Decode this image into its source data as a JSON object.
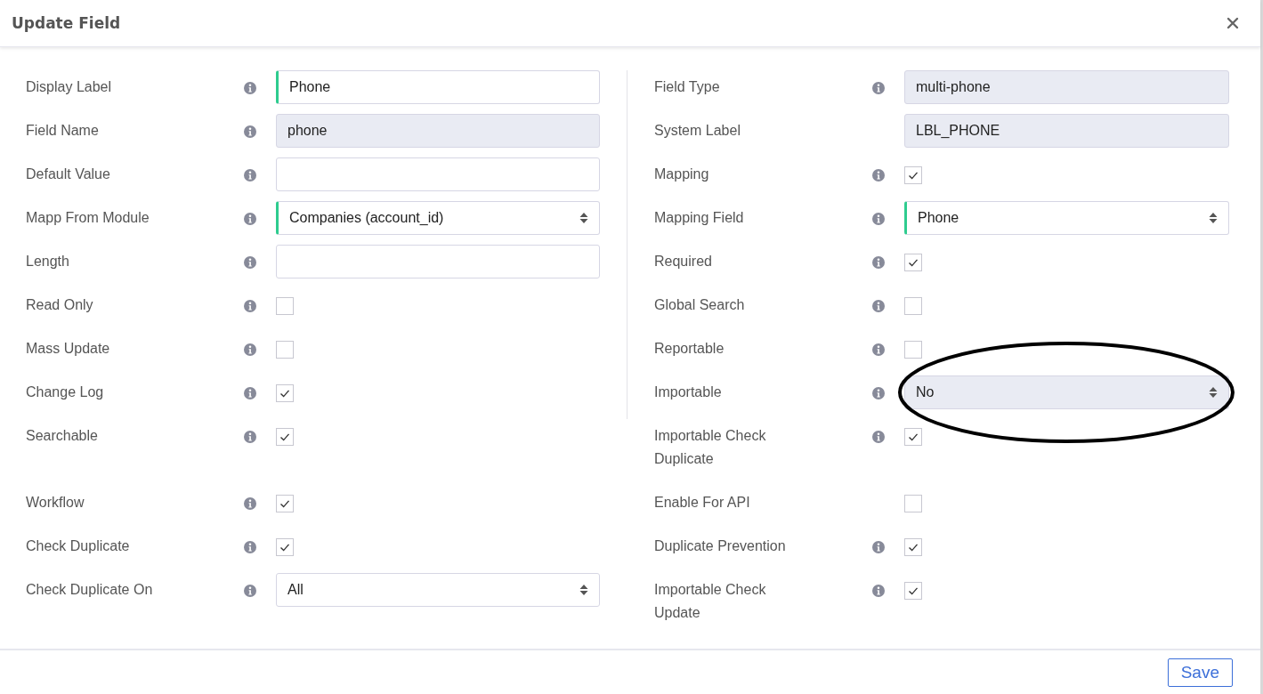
{
  "dialog": {
    "title": "Update Field"
  },
  "left_fields": [
    {
      "label": "Display Label",
      "info": true,
      "kind": "text",
      "value": "Phone",
      "required": true,
      "disabled": false
    },
    {
      "label": "Field Name",
      "info": true,
      "kind": "text",
      "value": "phone",
      "required": false,
      "disabled": true
    },
    {
      "label": "Default Value",
      "info": true,
      "kind": "text",
      "required": false,
      "disabled": false
    },
    {
      "label": "Mapp From Module",
      "info": true,
      "kind": "select",
      "value": "Companies (account_id)",
      "required": true,
      "disabled": false
    },
    {
      "label": "Length",
      "info": true,
      "kind": "text",
      "required": false,
      "disabled": false
    },
    {
      "label": "Read Only",
      "info": true,
      "kind": "checkbox",
      "checked": false
    },
    {
      "label": "Mass Update",
      "info": true,
      "kind": "checkbox",
      "checked": false
    },
    {
      "label": "Change Log",
      "info": true,
      "kind": "checkbox",
      "checked": true
    },
    {
      "label": "Searchable",
      "info": true,
      "kind": "checkbox",
      "checked": true
    },
    {
      "label": "Workflow",
      "info": true,
      "kind": "checkbox",
      "checked": true
    },
    {
      "label": "Check Duplicate",
      "info": true,
      "kind": "checkbox",
      "checked": true
    },
    {
      "label": "Check Duplicate On",
      "info": true,
      "kind": "select",
      "value": "All",
      "required": false,
      "disabled": false
    }
  ],
  "right_fields": [
    {
      "label": "Field Type",
      "info": true,
      "kind": "text",
      "value": "multi-phone",
      "required": false,
      "disabled": true
    },
    {
      "label": "System Label",
      "info": false,
      "kind": "text",
      "value": "LBL_PHONE",
      "required": false,
      "disabled": true
    },
    {
      "label": "Mapping",
      "info": true,
      "kind": "checkbox",
      "checked": true
    },
    {
      "label": "Mapping Field",
      "info": true,
      "kind": "select",
      "value": "Phone",
      "required": true,
      "disabled": false
    },
    {
      "label": "Required",
      "info": true,
      "kind": "checkbox",
      "checked": true
    },
    {
      "label": "Global Search",
      "info": true,
      "kind": "checkbox",
      "checked": false
    },
    {
      "label": "Reportable",
      "info": true,
      "kind": "checkbox",
      "checked": false
    },
    {
      "label": "Importable",
      "info": true,
      "kind": "select",
      "value": "No",
      "required": false,
      "disabled": true,
      "circled": true
    },
    {
      "label": "Importable Check Duplicate",
      "info": true,
      "kind": "checkbox",
      "checked": true
    },
    {
      "label": "Enable For API",
      "info": false,
      "kind": "checkbox",
      "checked": false
    },
    {
      "label": "Duplicate Prevention",
      "info": true,
      "kind": "checkbox",
      "checked": true
    },
    {
      "label": "Importable Check Update",
      "info": true,
      "kind": "checkbox",
      "checked": true
    }
  ],
  "footer": {
    "save_button": "Save"
  }
}
